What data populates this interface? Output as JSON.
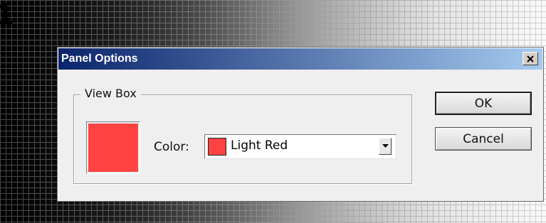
{
  "background": {
    "glyph": "1"
  },
  "dialog": {
    "title": "Panel Options",
    "title_bar_colors": {
      "start": "#0a246a",
      "end": "#a6caf0"
    },
    "close_icon": "close-icon",
    "view_box": {
      "legend": "View Box",
      "preview_color": "#ff4343",
      "color_label": "Color:",
      "color_select": {
        "value": "Light Red",
        "chip_color": "#ff4343",
        "arrow_icon": "chevron-down-icon"
      }
    },
    "buttons": {
      "ok": "OK",
      "cancel": "Cancel"
    }
  }
}
